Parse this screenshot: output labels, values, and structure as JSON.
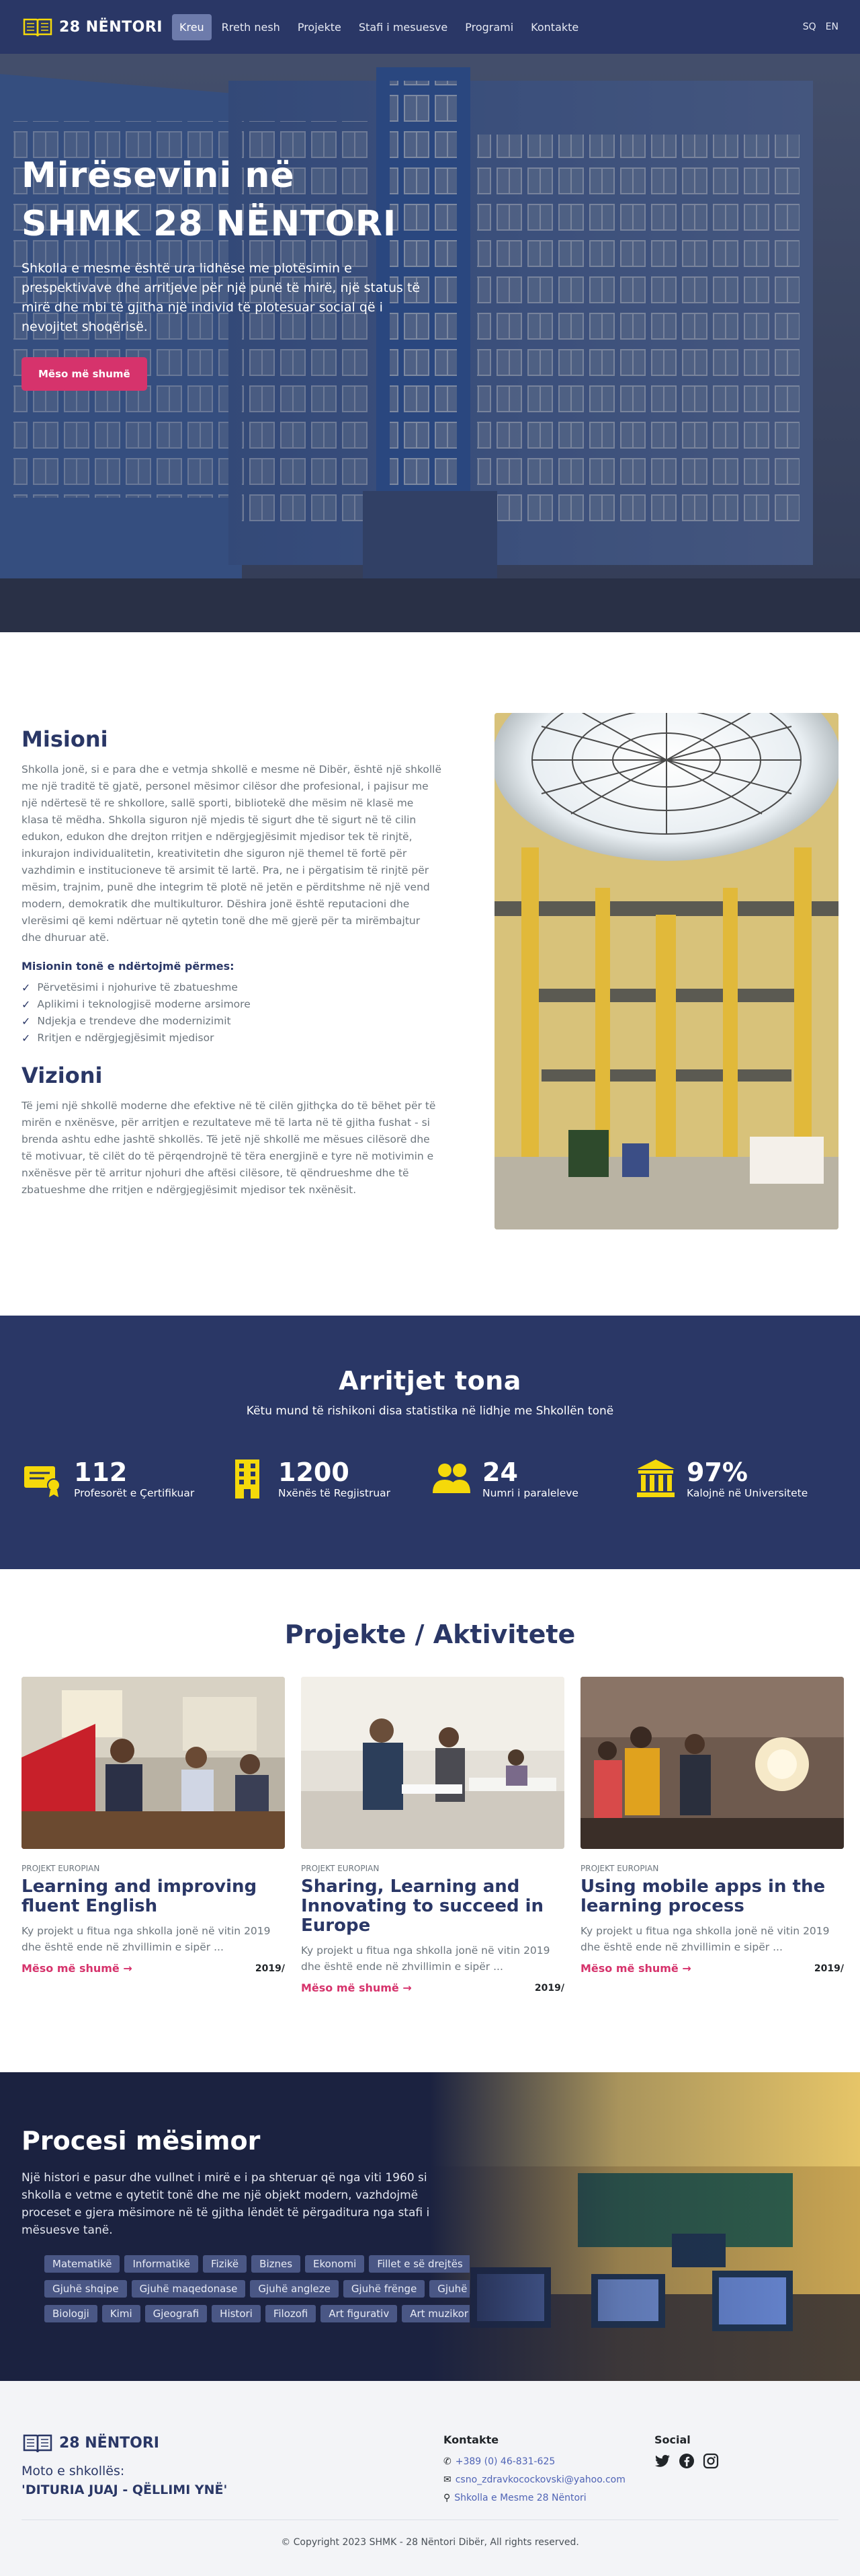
{
  "nav": {
    "brand": "28 NËNTORI",
    "items": [
      "Kreu",
      "Rreth nesh",
      "Projekte",
      "Stafi i mesuesve",
      "Programi",
      "Kontakte"
    ],
    "langs": [
      "SQ",
      "EN"
    ]
  },
  "hero": {
    "title_line1": "Mirësevini në",
    "title_line2": "SHMK 28 NËNTORI",
    "text": "Shkolla e mesme është ura lidhëse me plotësimin e prespektivave dhe arritjeve për një punë të mirë, një status të mirë dhe mbi të gjitha një individ të plotesuar social që i nevojitet shoqërisë.",
    "button": "Mëso më shumë"
  },
  "mission": {
    "title": "Misioni",
    "text": "Shkolla jonë, si e para dhe e vetmja shkollë e mesme në Dibër, është një shkollë me një traditë të gjatë, personel mësimor cilësor dhe profesional, i pajisur me një ndërtesë të re shkollore, sallë sporti, bibliotekë dhe mësim në klasë me klasa të mëdha. Shkolla siguron një mjedis të sigurt dhe të sigurt në të cilin edukon, edukon dhe drejton rritjen e ndërgjegjësimit mjedisor tek të rinjtë, inkurajon individualitetin, kreativitetin dhe siguron një themel të fortë për vazhdimin e institucioneve të arsimit të lartë. Pra, ne i përgatisim të rinjtë për mësim, trajnim, punë dhe integrim të plotë në jetën e përditshme në një vend modern, demokratik dhe multikulturor. Dëshira jonë është reputacioni dhe vlerësimi që kemi ndërtuar në qytetin tonë dhe më gjerë për ta mirëmbajtur dhe dhuruar atë.",
    "subtitle": "Misionin tonë e ndërtojmë përmes:",
    "list": [
      "Përvetësimi i njohurive të zbatueshme",
      "Aplikimi i teknologjisë moderne arsimore",
      "Ndjekja e trendeve dhe modernizimit",
      "Rritjen e ndërgjegjësimit mjedisor"
    ],
    "vision_title": "Vizioni",
    "vision_text": "Të jemi një shkollë moderne dhe efektive në të cilën gjithçka do të bëhet për të mirën e nxënësve, për arritjen e rezultateve më të larta në të gjitha fushat - si brenda ashtu edhe jashtë shkollës. Të jetë një shkollë me mësues cilësorë dhe të motivuar, të cilët do të përqendrojnë të tëra energjinë e tyre në motivimin e nxënësve për të arritur njohuri dhe aftësi cilësore, të qëndrueshme dhe të zbatueshme dhe rritjen e ndërgjegjësimit mjedisor tek nxënësit."
  },
  "stats": {
    "title": "Arritjet tona",
    "subtitle": "Këtu mund të rishikoni disa statistika në lidhje me Shkollën tonë",
    "items": [
      {
        "value": "112",
        "label": "Profesorët e Çertifikuar",
        "icon": "certificate-icon"
      },
      {
        "value": "1200",
        "label": "Nxënës të Regjistruar",
        "icon": "building-icon"
      },
      {
        "value": "24",
        "label": "Numri i paraleleve",
        "icon": "users-icon"
      },
      {
        "value": "97%",
        "label": "Kalojnë në Universitete",
        "icon": "university-icon"
      }
    ]
  },
  "projects": {
    "title": "Projekte / Aktivitete",
    "items": [
      {
        "category": "PROJEKT EUROPIAN",
        "title": "Learning and improving fluent English",
        "text": "Ky projekt u fitua nga shkolla jonë në vitin 2019 dhe është ende në zhvillimin e sipër ...",
        "link": "Mëso më shumë",
        "year": "2019/"
      },
      {
        "category": "PROJEKT EUROPIAN",
        "title": "Sharing, Learning and Innovating to succeed in Europe",
        "text": "Ky projekt u fitua nga shkolla jonë në vitin 2019 dhe është ende në zhvillimin e sipër ...",
        "link": "Mëso më shumë",
        "year": "2019/"
      },
      {
        "category": "PROJEKT EUROPIAN",
        "title": "Using mobile apps in the learning process",
        "text": "Ky projekt u fitua nga shkolla jonë në vitin 2019 dhe është ende në zhvillimin e sipër ...",
        "link": "Mëso më shumë",
        "year": "2019/"
      }
    ]
  },
  "process": {
    "title": "Procesi mësimor",
    "text": "Një histori e pasur dhe vullnet i mirë e i pa shteruar që nga viti 1960 si shkolla e vetme e qytetit tonë dhe me një objekt modern, vazhdojmë proceset e gjera mësimore në të gjitha lëndët të përgaditura nga stafi i mësuesve tanë.",
    "tags_row1": [
      "Matematikë",
      "Informatikë",
      "Fizikë",
      "Biznes",
      "Ekonomi",
      "Fillet e së drejtës"
    ],
    "tags_row2": [
      "Gjuhë shqipe",
      "Gjuhë maqedonase",
      "Gjuhë angleze",
      "Gjuhë frënge",
      "Gjuhë"
    ],
    "tags_row3": [
      "Biologji",
      "Kimi",
      "Gjeografi",
      "Histori",
      "Filozofi",
      "Art figurativ",
      "Art muzikor"
    ]
  },
  "footer": {
    "brand": "28 NËNTORI",
    "moto_label": "Moto e shkollës:",
    "moto": "'DITURIA JUAJ - QËLLIMI YNË'",
    "contacts_title": "Kontakte",
    "phone": "+389 (0) 46-831-625",
    "email": "csno_zdravkocockovski@yahoo.com",
    "address": "Shkolla e Mesme 28 Nëntori",
    "social_title": "Social",
    "copyright": "© Copyright 2023 SHMK - 28 Nëntori Dibër, All rights reserved."
  },
  "colors": {
    "primary": "#2a3766",
    "accent": "#d6336c",
    "icon_yellow": "#f5d90a"
  }
}
